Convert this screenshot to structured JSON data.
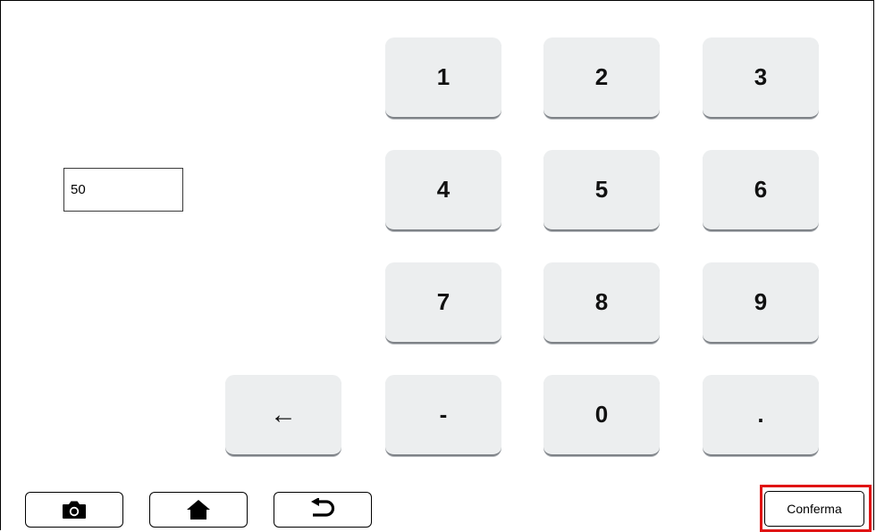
{
  "display": {
    "value": "50"
  },
  "keypad": {
    "k1": "1",
    "k2": "2",
    "k3": "3",
    "k4": "4",
    "k5": "5",
    "k6": "6",
    "k7": "7",
    "k8": "8",
    "k9": "9",
    "backspace": "←",
    "minus": "-",
    "k0": "0",
    "dot": "."
  },
  "toolbar": {
    "camera_icon": "camera-icon",
    "home_icon": "home-icon",
    "back_icon": "undo-arrow-icon",
    "confirm_label": "Conferma"
  },
  "colors": {
    "key_background": "#eceeef",
    "confirm_highlight": "#e01414"
  }
}
